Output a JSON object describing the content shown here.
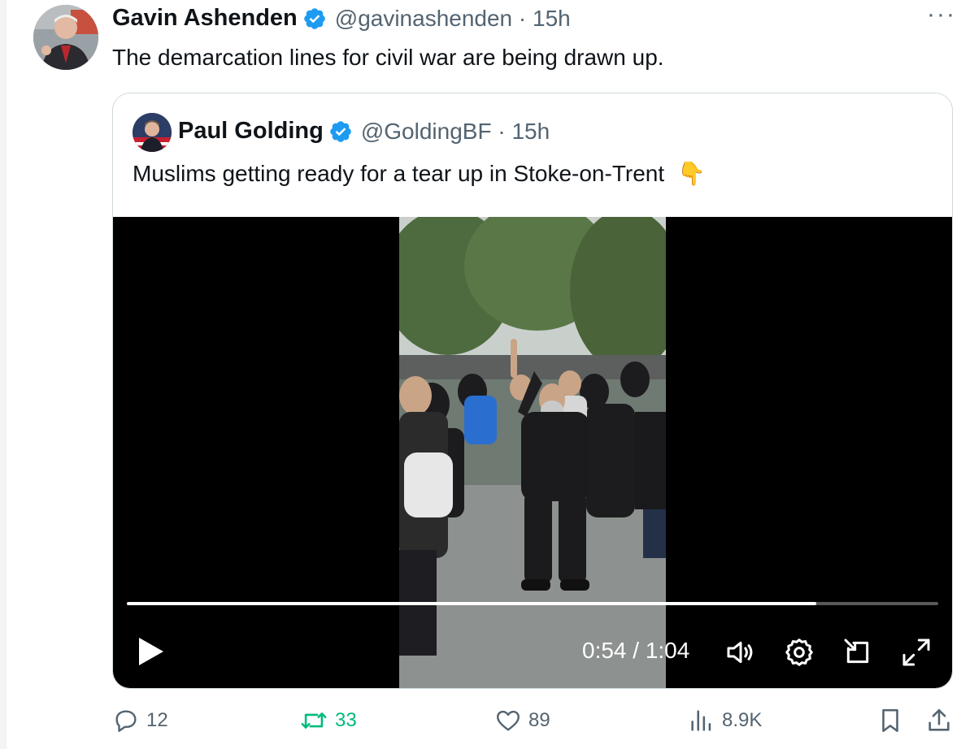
{
  "tweet": {
    "author_name": "Gavin Ashenden",
    "handle_time": "@gavinashenden · 15h",
    "more_label": "···",
    "text": "The demarcation lines for civil war are being drawn up."
  },
  "quote": {
    "author_name": "Paul Golding",
    "handle_time": "@GoldingBF · 15h",
    "text": "Muslims getting ready for a tear up in Stoke-on-Trent",
    "emoji": "👇"
  },
  "video": {
    "time": "0:54 / 1:04",
    "progress_fraction": 0.85
  },
  "actions": {
    "replies": "12",
    "reposts": "33",
    "likes": "89",
    "views": "8.9K"
  },
  "colors": {
    "verified": "#1d9bf0",
    "repost_active": "#00ba7c",
    "muted_text": "#536471",
    "border": "#cfd9de"
  },
  "icons": [
    "verified-badge-icon",
    "more-icon",
    "play-icon",
    "volume-icon",
    "settings-gear-icon",
    "minimize-player-icon",
    "fullscreen-icon",
    "reply-icon",
    "repost-icon",
    "like-icon",
    "views-icon",
    "bookmark-icon",
    "share-icon"
  ]
}
